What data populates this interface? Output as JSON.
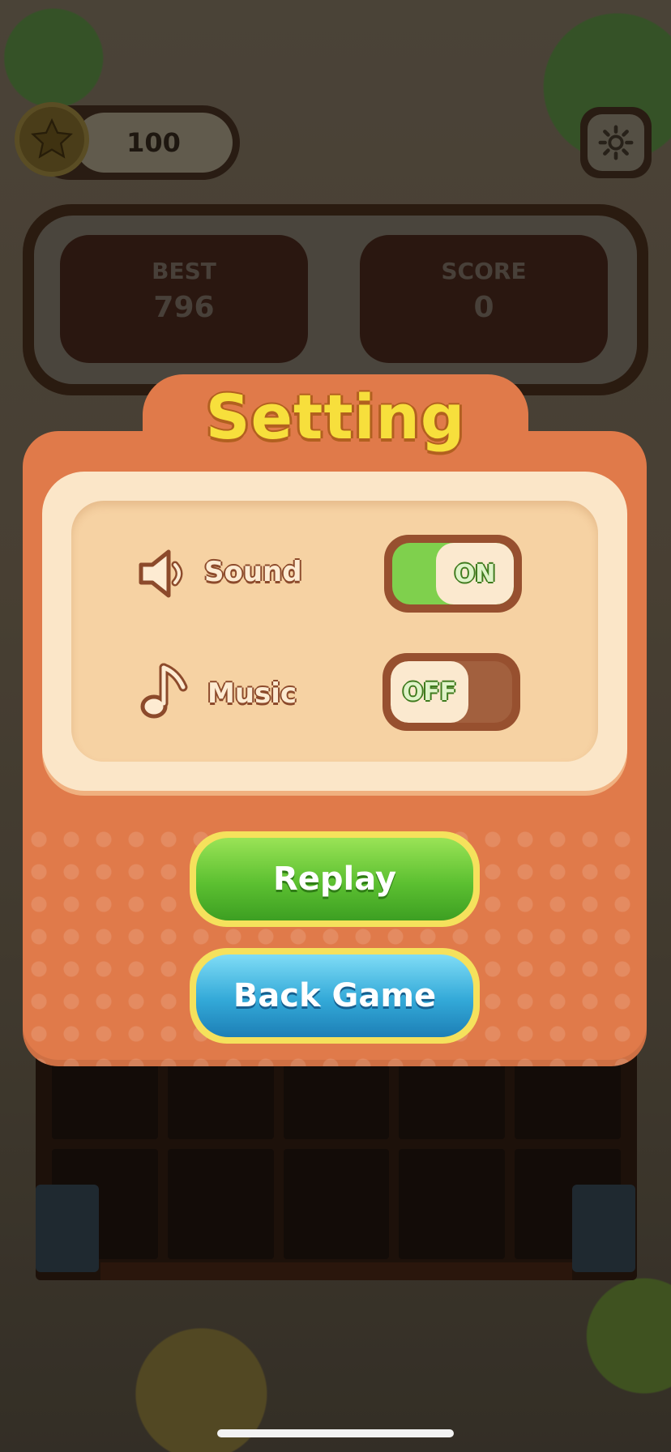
{
  "hud": {
    "coins": "100",
    "best_label": "BEST",
    "best_value": "796",
    "score_label": "SCORE",
    "score_value": "0"
  },
  "dialog": {
    "title": "Setting",
    "sound_label": "Sound",
    "sound_state": "ON",
    "music_label": "Music",
    "music_state": "OFF",
    "replay_label": "Replay",
    "back_label": "Back Game"
  },
  "colors": {
    "dialog": "#e07a4a",
    "title": "#f7df3c",
    "toggle_on": "#7fd04d",
    "replay_button": "#5cc031",
    "back_button": "#33a9d8"
  },
  "icons": [
    "star-icon",
    "gear-icon",
    "speaker-icon",
    "music-note-icon"
  ]
}
